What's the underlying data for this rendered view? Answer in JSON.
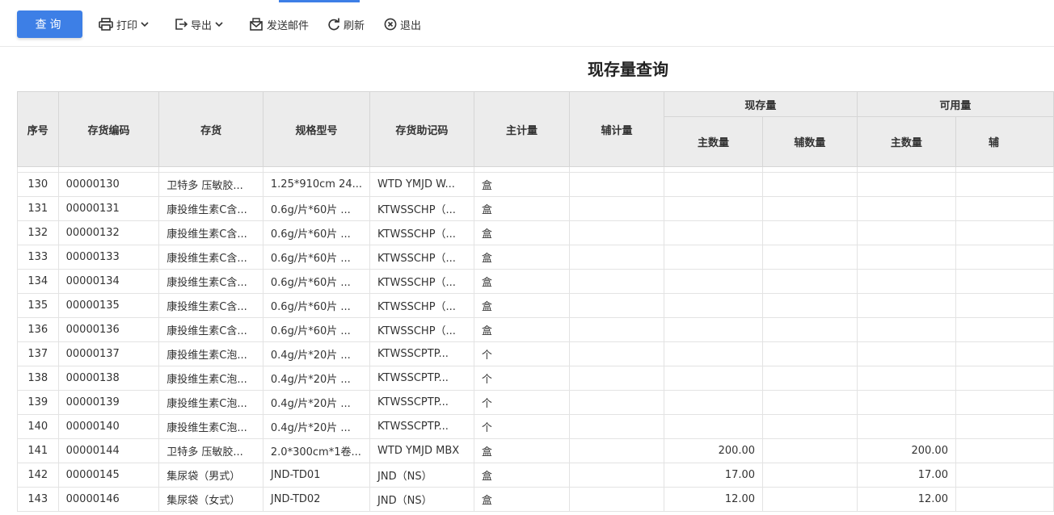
{
  "toolbar": {
    "query_label": "查询",
    "print_label": "打印",
    "export_label": "导出",
    "email_label": "发送邮件",
    "refresh_label": "刷新",
    "exit_label": "退出"
  },
  "report": {
    "title": "现存量查询"
  },
  "columns": {
    "seq": "序号",
    "code": "存货编码",
    "name": "存货",
    "spec": "规格型号",
    "mnemonic": "存货助记码",
    "main_unit": "主计量",
    "aux_unit": "辅计量",
    "onhand": "现存量",
    "available": "可用量",
    "main_qty": "主数量",
    "aux_qty": "辅数量",
    "aux_qty_cut": "辅"
  },
  "rows": [
    {
      "seq": "130",
      "code": "00000130",
      "name": "卫特多 压敏胶...",
      "spec": "1.25*910cm 24...",
      "mnemonic": "WTD YMJD W...",
      "unit": "盒",
      "onhand": "",
      "available": ""
    },
    {
      "seq": "131",
      "code": "00000131",
      "name": "康投维生素C含...",
      "spec": "0.6g/片*60片 ...",
      "mnemonic": "KTWSSCHP（...",
      "unit": "盒",
      "onhand": "",
      "available": ""
    },
    {
      "seq": "132",
      "code": "00000132",
      "name": "康投维生素C含...",
      "spec": "0.6g/片*60片 ...",
      "mnemonic": "KTWSSCHP（...",
      "unit": "盒",
      "onhand": "",
      "available": ""
    },
    {
      "seq": "133",
      "code": "00000133",
      "name": "康投维生素C含...",
      "spec": "0.6g/片*60片 ...",
      "mnemonic": "KTWSSCHP（...",
      "unit": "盒",
      "onhand": "",
      "available": ""
    },
    {
      "seq": "134",
      "code": "00000134",
      "name": "康投维生素C含...",
      "spec": "0.6g/片*60片 ...",
      "mnemonic": "KTWSSCHP（...",
      "unit": "盒",
      "onhand": "",
      "available": ""
    },
    {
      "seq": "135",
      "code": "00000135",
      "name": "康投维生素C含...",
      "spec": "0.6g/片*60片 ...",
      "mnemonic": "KTWSSCHP（...",
      "unit": "盒",
      "onhand": "",
      "available": ""
    },
    {
      "seq": "136",
      "code": "00000136",
      "name": "康投维生素C含...",
      "spec": "0.6g/片*60片 ...",
      "mnemonic": "KTWSSCHP（...",
      "unit": "盒",
      "onhand": "",
      "available": ""
    },
    {
      "seq": "137",
      "code": "00000137",
      "name": "康投维生素C泡...",
      "spec": "0.4g/片*20片 ...",
      "mnemonic": "KTWSSCPTP...",
      "unit": "个",
      "onhand": "",
      "available": ""
    },
    {
      "seq": "138",
      "code": "00000138",
      "name": "康投维生素C泡...",
      "spec": "0.4g/片*20片 ...",
      "mnemonic": "KTWSSCPTP...",
      "unit": "个",
      "onhand": "",
      "available": ""
    },
    {
      "seq": "139",
      "code": "00000139",
      "name": "康投维生素C泡...",
      "spec": "0.4g/片*20片 ...",
      "mnemonic": "KTWSSCPTP...",
      "unit": "个",
      "onhand": "",
      "available": ""
    },
    {
      "seq": "140",
      "code": "00000140",
      "name": "康投维生素C泡...",
      "spec": "0.4g/片*20片 ...",
      "mnemonic": "KTWSSCPTP...",
      "unit": "个",
      "onhand": "",
      "available": ""
    },
    {
      "seq": "141",
      "code": "00000144",
      "name": "卫特多 压敏胶...",
      "spec": "2.0*300cm*1卷...",
      "mnemonic": "WTD YMJD MBX",
      "unit": "盒",
      "onhand": "200.00",
      "available": "200.00"
    },
    {
      "seq": "142",
      "code": "00000145",
      "name": "集尿袋（男式）",
      "spec": "JND-TD01",
      "mnemonic": "JND（NS）",
      "unit": "盒",
      "onhand": "17.00",
      "available": "17.00"
    },
    {
      "seq": "143",
      "code": "00000146",
      "name": "集尿袋（女式）",
      "spec": "JND-TD02",
      "mnemonic": "JND（NS）",
      "unit": "盒",
      "onhand": "12.00",
      "available": "12.00"
    }
  ],
  "colors": {
    "primary": "#3d7fe6",
    "header_bg": "#ececec"
  }
}
